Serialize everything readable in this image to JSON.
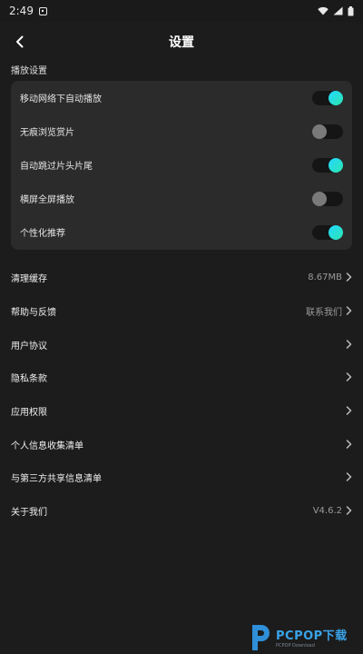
{
  "status_bar": {
    "time": "2:49"
  },
  "header": {
    "title": "设置"
  },
  "playback": {
    "section_label": "播放设置",
    "toggles": [
      {
        "label": "移动网络下自动播放",
        "on": true
      },
      {
        "label": "无痕浏览赏片",
        "on": false
      },
      {
        "label": "自动跳过片头片尾",
        "on": true
      },
      {
        "label": "横屏全屏播放",
        "on": false
      },
      {
        "label": "个性化推荐",
        "on": true
      }
    ]
  },
  "menu": [
    {
      "label": "清理缓存",
      "value": "8.67MB"
    },
    {
      "label": "帮助与反馈",
      "value": "联系我们"
    },
    {
      "label": "用户协议",
      "value": ""
    },
    {
      "label": "隐私条款",
      "value": ""
    },
    {
      "label": "应用权限",
      "value": ""
    },
    {
      "label": "个人信息收集清单",
      "value": ""
    },
    {
      "label": "与第三方共享信息清单",
      "value": ""
    },
    {
      "label": "关于我们",
      "value": "V4.6.2"
    }
  ],
  "watermark": {
    "brand": "PCPOP下载",
    "sub": "PCPOP Download"
  },
  "colors": {
    "accent_start": "#22d8ff",
    "accent_end": "#2ee6b0",
    "background": "#1c1c1c",
    "card": "#2b2b2b"
  }
}
